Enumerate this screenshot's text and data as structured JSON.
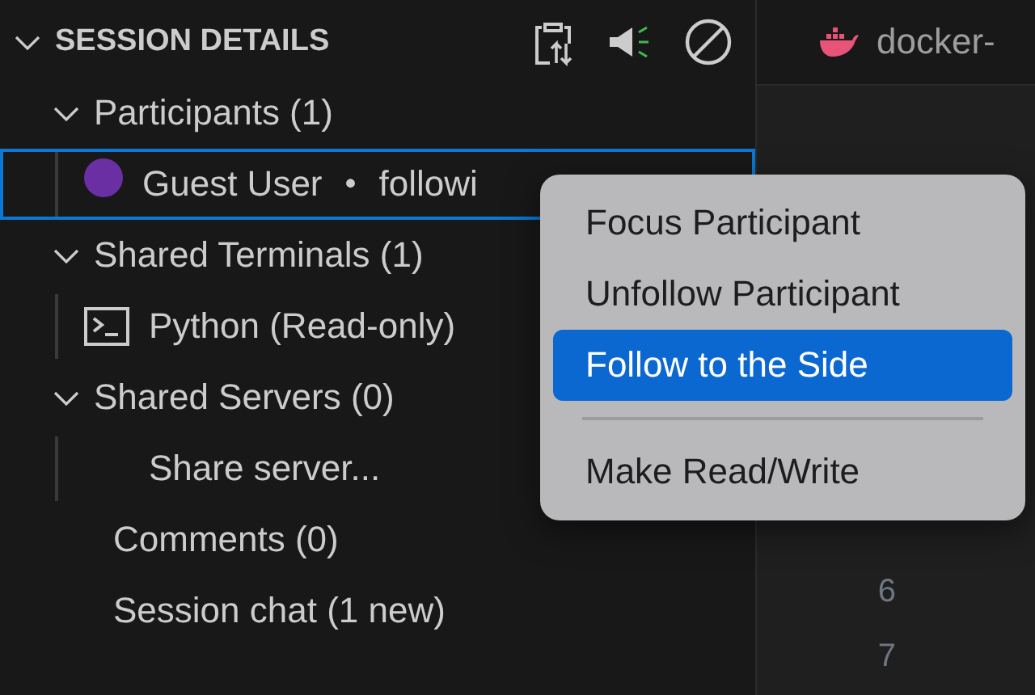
{
  "sidebar": {
    "title": "SESSION DETAILS",
    "expanded": true,
    "tree": [
      {
        "kind": "group",
        "label": "Participants (1)",
        "expanded": true,
        "children": [
          {
            "kind": "participant",
            "label": "Guest User",
            "separator": "•",
            "status": "followi",
            "color": "#6a2fa3",
            "selected": true
          }
        ]
      },
      {
        "kind": "group",
        "label": "Shared Terminals (1)",
        "expanded": true,
        "children": [
          {
            "kind": "terminal",
            "label": "Python (Read-only)",
            "selected": false
          }
        ]
      },
      {
        "kind": "group",
        "label": "Shared Servers (0)",
        "expanded": true,
        "children": [
          {
            "kind": "action",
            "label": "Share server...",
            "selected": false
          }
        ]
      },
      {
        "kind": "leaf",
        "label": "Comments (0)"
      },
      {
        "kind": "leaf",
        "label": "Session chat (1 new)"
      }
    ]
  },
  "editor": {
    "tab": "docker-",
    "line_numbers": [
      "6",
      "7"
    ]
  },
  "context_menu": [
    {
      "kind": "item",
      "label": "Focus Participant",
      "selected": false
    },
    {
      "kind": "item",
      "label": "Unfollow Participant",
      "selected": false
    },
    {
      "kind": "item",
      "label": "Follow to the Side",
      "selected": true
    },
    {
      "kind": "separator"
    },
    {
      "kind": "item",
      "label": "Make Read/Write",
      "selected": false
    }
  ]
}
